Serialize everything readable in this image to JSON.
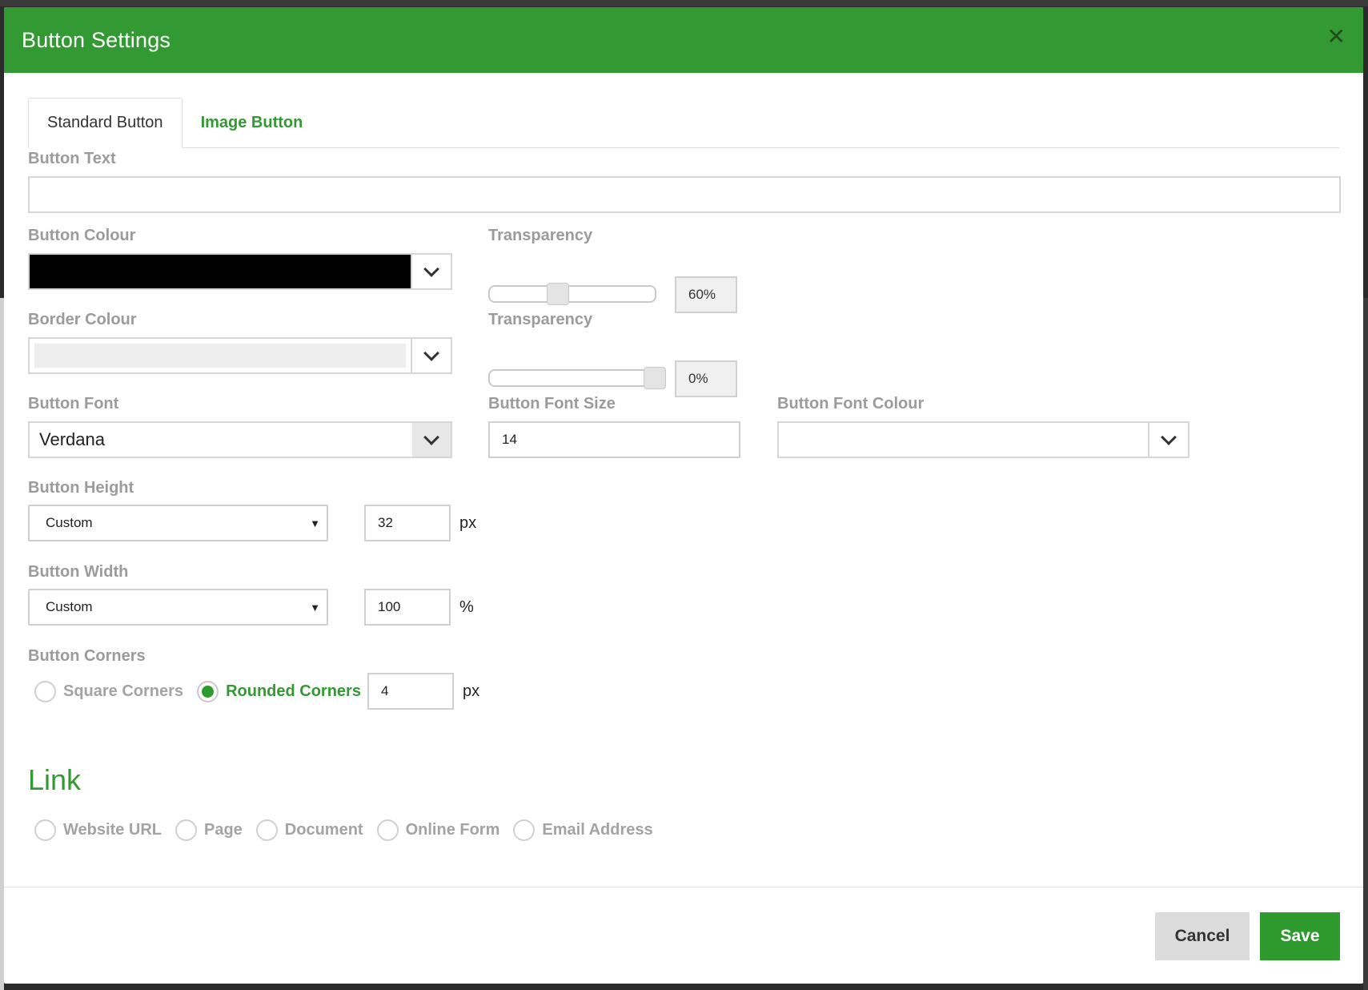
{
  "modal": {
    "title": "Button Settings",
    "close_glyph": "✕"
  },
  "tabs": [
    {
      "label": "Standard Button",
      "active": true
    },
    {
      "label": "Image Button",
      "active": false
    }
  ],
  "button_text": {
    "label": "Button Text",
    "value": ""
  },
  "button_colour": {
    "label": "Button Colour",
    "swatch": "#000000"
  },
  "button_transparency": {
    "label": "Transparency",
    "value": "60%",
    "level": 0.6
  },
  "border_colour": {
    "label": "Border Colour",
    "swatch": "#eeeeee"
  },
  "border_transparency": {
    "label": "Transparency",
    "value": "0%",
    "level": 0.0
  },
  "button_font": {
    "label": "Button Font",
    "value": "Verdana"
  },
  "button_font_size": {
    "label": "Button Font Size",
    "value": "14"
  },
  "button_font_colour": {
    "label": "Button Font Colour",
    "value": ""
  },
  "button_height": {
    "label": "Button Height",
    "mode": "Custom",
    "value": "32",
    "unit": "px"
  },
  "button_width": {
    "label": "Button Width",
    "mode": "Custom",
    "value": "100",
    "unit": "%"
  },
  "button_corners": {
    "label": "Button Corners",
    "options": [
      {
        "label": "Square Corners",
        "checked": false
      },
      {
        "label": "Rounded Corners",
        "checked": true
      }
    ],
    "radius": "4",
    "unit": "px"
  },
  "link": {
    "title": "Link",
    "options": [
      {
        "label": "Website URL"
      },
      {
        "label": "Page"
      },
      {
        "label": "Document"
      },
      {
        "label": "Online Form"
      },
      {
        "label": "Email Address"
      }
    ]
  },
  "footer": {
    "cancel": "Cancel",
    "save": "Save"
  },
  "colors": {
    "accent": "#339933",
    "header": "#339933",
    "save": "#2e9a2e",
    "cancel": "#dcdcdc"
  }
}
